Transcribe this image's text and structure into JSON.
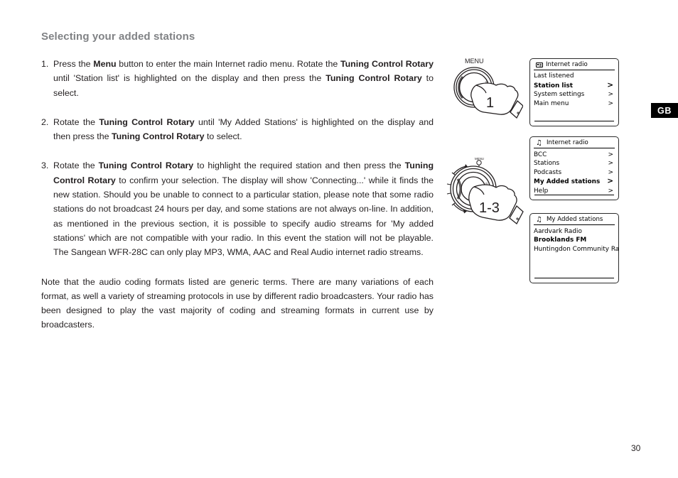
{
  "page": {
    "heading": "Selecting your added stations",
    "number": "30",
    "language_tab": "GB"
  },
  "steps": [
    {
      "number": "1.",
      "runs": [
        {
          "t": "Press the ",
          "b": false
        },
        {
          "t": "Menu",
          "b": true
        },
        {
          "t": " button to enter the main Internet radio menu. Rotate the ",
          "b": false
        },
        {
          "t": "Tuning Control Rotary",
          "b": true
        },
        {
          "t": " until 'Station list' is highlighted on the display and then press the ",
          "b": false
        },
        {
          "t": "Tuning Control Rotary",
          "b": true
        },
        {
          "t": " to select.",
          "b": false
        }
      ]
    },
    {
      "number": "2.",
      "runs": [
        {
          "t": "Rotate the ",
          "b": false
        },
        {
          "t": "Tuning Control Rotary",
          "b": true
        },
        {
          "t": " until 'My Added Stations' is highlighted on the display and then press the ",
          "b": false
        },
        {
          "t": "Tuning Control Rotary",
          "b": true
        },
        {
          "t": " to select.",
          "b": false
        }
      ]
    },
    {
      "number": "3.",
      "runs": [
        {
          "t": "Rotate the ",
          "b": false
        },
        {
          "t": "Tuning Control Rotary",
          "b": true
        },
        {
          "t": " to highlight the required station and then press the ",
          "b": false
        },
        {
          "t": "Tuning Control Rotary",
          "b": true
        },
        {
          "t": " to confirm your selection. The display will show 'Connecting...' while it finds the new station. Should you be unable to connect to a particular station, please note that some radio stations do not broadcast 24 hours per day, and some stations are not always on-line. In addition, as mentioned in the previous section, it is possible to specify audio streams for 'My added stations' which are not compatible with your radio. In this event the station will not be playable. The Sangean WFR-28C can only play MP3, WMA, AAC and Real Audio internet radio streams.",
          "b": false
        }
      ]
    }
  ],
  "note_paragraph": "Note that the audio coding formats listed are generic terms. There are many variations of each format, as well a variety of streaming protocols in use by different radio broadcasters. Your radio has been designed to play the vast majority of coding and streaming formats in current use by broadcasters.",
  "illustrations": [
    {
      "knob_label": "MENU",
      "hand_label": "1"
    },
    {
      "knob_label": "MENU",
      "hand_label": "1-3"
    }
  ],
  "displays": [
    {
      "icon": "screen-icon",
      "title": "Internet radio",
      "rows": [
        {
          "label": "Last listened",
          "arrow": "",
          "selected": false
        },
        {
          "label": "Station list",
          "arrow": ">",
          "selected": true
        },
        {
          "label": "System settings",
          "arrow": ">",
          "selected": false
        },
        {
          "label": "Main menu",
          "arrow": ">",
          "selected": false
        }
      ]
    },
    {
      "icon": "music-notes-icon",
      "title": "Internet radio",
      "rows": [
        {
          "label": "BCC",
          "arrow": ">",
          "selected": false
        },
        {
          "label": "Stations",
          "arrow": ">",
          "selected": false
        },
        {
          "label": "Podcasts",
          "arrow": ">",
          "selected": false
        },
        {
          "label": "My Added stations",
          "arrow": ">",
          "selected": true
        },
        {
          "label": "Help",
          "arrow": ">",
          "selected": false
        }
      ]
    },
    {
      "icon": "music-notes-icon",
      "title": "My Added stations",
      "rows": [
        {
          "label": "Aardvark Radio",
          "arrow": "",
          "selected": false
        },
        {
          "label": "Brooklands FM",
          "arrow": "",
          "selected": true
        },
        {
          "label": "Huntingdon Community Ra",
          "arrow": "",
          "selected": false
        }
      ]
    }
  ]
}
